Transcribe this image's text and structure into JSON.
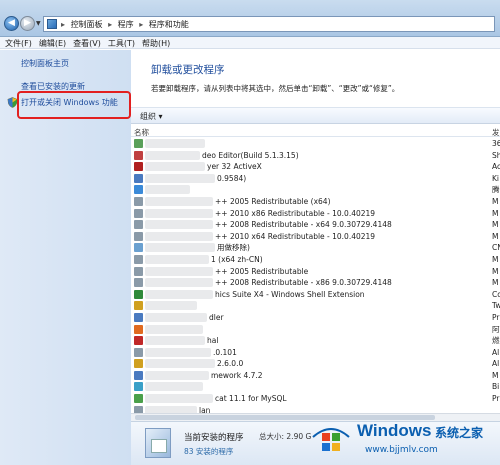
{
  "address": {
    "crumbs": [
      "控制面板",
      "程序",
      "程序和功能"
    ]
  },
  "menu": [
    "文件(F)",
    "编辑(E)",
    "查看(V)",
    "工具(T)",
    "帮助(H)"
  ],
  "left": {
    "home": "控制面板主页",
    "updates": "查看已安装的更新",
    "features": "打开或关闭 Windows 功能"
  },
  "main": {
    "title": "卸载或更改程序",
    "description": "若要卸载程序，请从列表中将其选中，然后单击“卸载”、“更改”或“修复”。",
    "organize": "组织 ▾",
    "col_name": "名称",
    "col_publisher": "发"
  },
  "programs": [
    {
      "name": "",
      "pub": "36",
      "color": "#5aa05a"
    },
    {
      "name": "deo Editor(Build 5.1.3.15)",
      "pub": "Sh",
      "color": "#c04040"
    },
    {
      "name": "yer 32 ActiveX",
      "pub": "Ac",
      "color": "#b02020"
    },
    {
      "name": "0.9584)",
      "pub": "Ki",
      "color": "#4a7ac0"
    },
    {
      "name": "",
      "pub": "腾",
      "color": "#3b8ad8"
    },
    {
      "name": "++ 2005 Redistributable (x64)",
      "pub": "M",
      "color": "#8a9aa8"
    },
    {
      "name": "++ 2010  x86 Redistributable - 10.0.40219",
      "pub": "M",
      "color": "#8a9aa8"
    },
    {
      "name": "++ 2008 Redistributable - x64 9.0.30729.4148",
      "pub": "M",
      "color": "#8a9aa8"
    },
    {
      "name": "++ 2010  x64 Redistributable - 10.0.40219",
      "pub": "M",
      "color": "#8a9aa8"
    },
    {
      "name": "用做移除)",
      "pub": "CN",
      "color": "#6aa0d0"
    },
    {
      "name": "1 (x64 zh-CN)",
      "pub": "M",
      "color": "#8a9aa8"
    },
    {
      "name": "++ 2005 Redistributable",
      "pub": "M",
      "color": "#8a9aa8"
    },
    {
      "name": "++ 2008 Redistributable - x86 9.0.30729.4148",
      "pub": "M",
      "color": "#8a9aa8"
    },
    {
      "name": "hics Suite X4 - Windows Shell Extension",
      "pub": "Co",
      "color": "#2f8a3a"
    },
    {
      "name": "",
      "pub": "Tw",
      "color": "#d0a020"
    },
    {
      "name": "dler",
      "pub": "Pr",
      "color": "#4a7ac0"
    },
    {
      "name": "",
      "pub": "阿",
      "color": "#e06a20"
    },
    {
      "name": "hal",
      "pub": "燃",
      "color": "#c02828"
    },
    {
      "name": ".0.101",
      "pub": "Al",
      "color": "#8a9aa8"
    },
    {
      "name": "2.6.0.0",
      "pub": "Al",
      "color": "#d0a020"
    },
    {
      "name": "mework 4.7.2",
      "pub": "M",
      "color": "#4a7ac0"
    },
    {
      "name": "",
      "pub": "Bi",
      "color": "#3aa0c8"
    },
    {
      "name": "cat 11.1 for MySQL",
      "pub": "Pr",
      "color": "#4aa04a"
    },
    {
      "name": "lan",
      "pub": "",
      "color": "#8a9aa8"
    }
  ],
  "details": {
    "title": "当前安装的程序",
    "size": "总大小: 2.90 G",
    "count": "83 安装的程序"
  },
  "watermark": {
    "brand": "Windows",
    "cn": "系统之家",
    "url": "www.bjjmlv.com"
  }
}
